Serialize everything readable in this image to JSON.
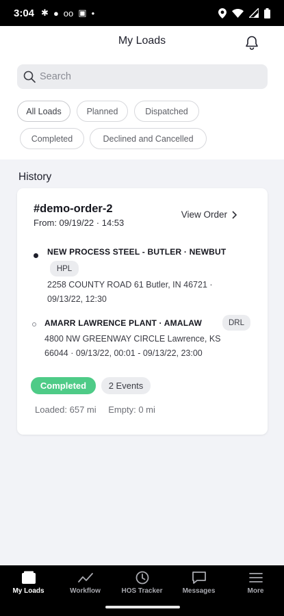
{
  "status_bar": {
    "time": "3:04"
  },
  "header": {
    "title": "My Loads"
  },
  "search": {
    "placeholder": "Search",
    "value": ""
  },
  "filters": [
    {
      "label": "All Loads",
      "active": true
    },
    {
      "label": "Planned",
      "active": false
    },
    {
      "label": "Dispatched",
      "active": false
    },
    {
      "label": "Completed",
      "active": false
    },
    {
      "label": "Declined and Cancelled",
      "active": false
    }
  ],
  "section": {
    "title": "History"
  },
  "order": {
    "id": "#demo-order-2",
    "from": "From: 09/19/22 · 14:53",
    "view_label": "View Order",
    "stops": [
      {
        "name": "NEW PROCESS STEEL - BUTLER · NEWBUT",
        "tag": "HPL",
        "address_line1": "2258 COUNTY ROAD 61 Butler, IN 46721 ·",
        "address_line2": "09/13/22, 12:30"
      },
      {
        "name": "AMARR LAWRENCE PLANT · AMALAW",
        "tag": "DRL",
        "address_line1": "4800 NW GREENWAY CIRCLE Lawrence, KS",
        "address_line2": "66044 · 09/13/22, 00:01 - 09/13/22, 23:00"
      }
    ],
    "status": "Completed",
    "events": "2 Events",
    "loaded": "Loaded: 657 mi",
    "empty": "Empty: 0 mi"
  },
  "bottom_nav": [
    {
      "label": "My Loads",
      "icon": "truck-icon",
      "active": true
    },
    {
      "label": "Workflow",
      "icon": "workflow-icon",
      "active": false
    },
    {
      "label": "HOS Tracker",
      "icon": "clock-icon",
      "active": false
    },
    {
      "label": "Messages",
      "icon": "message-icon",
      "active": false
    },
    {
      "label": "More",
      "icon": "menu-icon",
      "active": false
    }
  ],
  "colors": {
    "accent_green": "#4ecb87",
    "nav_background": "#000000"
  }
}
